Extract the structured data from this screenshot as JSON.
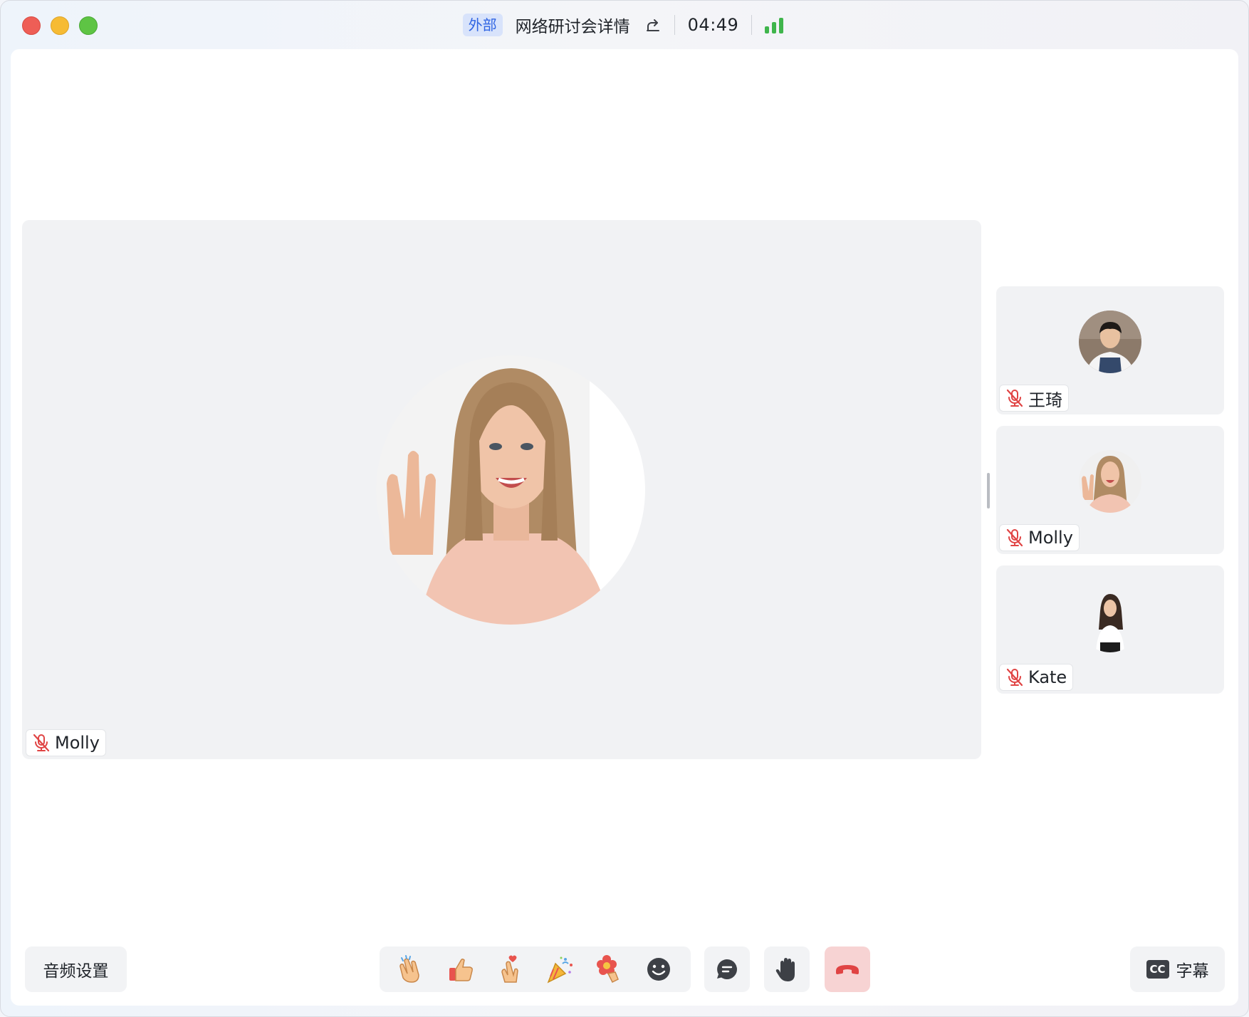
{
  "titlebar": {
    "tag": "外部",
    "title": "网络研讨会详情",
    "timer": "04:49",
    "signal_bars": 3
  },
  "stage": {
    "speaker_name": "Molly",
    "muted": true
  },
  "participants": [
    {
      "name": "王琦",
      "muted": true
    },
    {
      "name": "Molly",
      "muted": true
    },
    {
      "name": "Kate",
      "muted": true
    }
  ],
  "toolbar": {
    "audio_settings": "音频设置",
    "reactions": [
      "clap-icon",
      "thumbs-up-icon",
      "finger-heart-icon",
      "party-popper-icon",
      "flower-icon",
      "emoji-icon"
    ],
    "chat_icon": "chat-icon",
    "raise_hand_icon": "raise-hand-icon",
    "leave_icon": "hang-up-icon",
    "captions_badge": "CC",
    "captions_label": "字幕"
  },
  "colors": {
    "muted_red": "#e04444",
    "tag_blue": "#2f64e3",
    "signal_green": "#3fb54c",
    "leave_bg": "#f7d3d3"
  }
}
